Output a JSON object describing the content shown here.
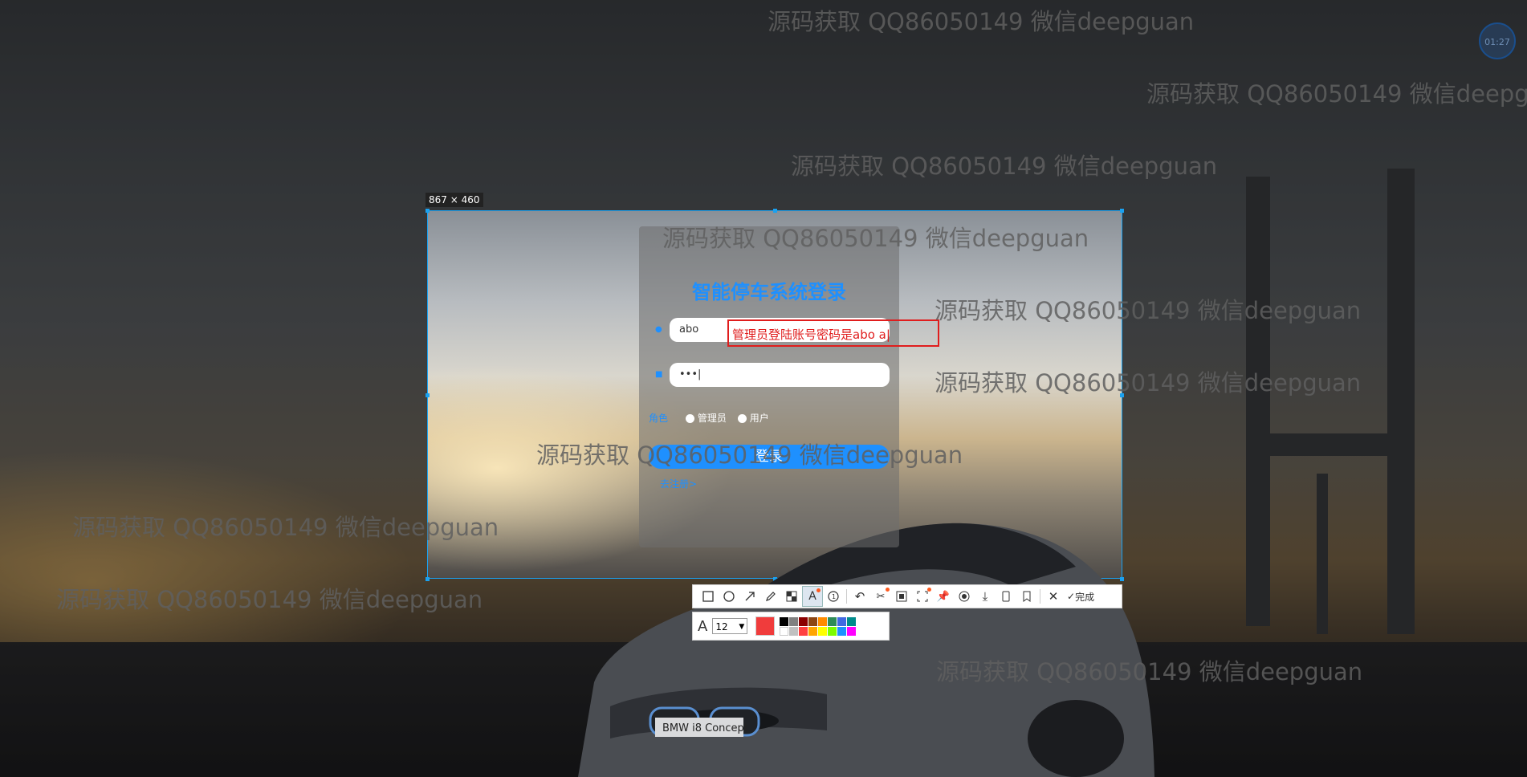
{
  "selection": {
    "size_label": "867 × 460"
  },
  "login": {
    "title": "智能停车系统登录",
    "username_value": "abo",
    "password_value": "•••|",
    "role_label": "角色",
    "role_options": [
      "管理员",
      "用户"
    ],
    "login_button": "登录",
    "register_link": "去注册>"
  },
  "annotation": {
    "text": "管理员登陆账号密码是abo a|"
  },
  "watermark": {
    "text": "源码获取 QQ86050149 微信deepguan"
  },
  "timer": {
    "text": "01:27"
  },
  "toolbar": {
    "tools": [
      "rectangle-icon",
      "ellipse-icon",
      "arrow-icon",
      "pencil-icon",
      "mosaic-icon",
      "text-icon",
      "number-icon",
      "undo-icon",
      "cut-icon",
      "ocr-icon",
      "screenshot-icon",
      "pin-icon",
      "record-icon",
      "download-icon",
      "phone-icon",
      "bookmark-icon"
    ],
    "close_icon": "close-icon",
    "done_label": "完成"
  },
  "text_toolbar": {
    "font_size": "12",
    "current_color": "#f03c3c",
    "palette": [
      "#000000",
      "#808080",
      "#8b0000",
      "#8b4513",
      "#ff8c00",
      "#2e8b57",
      "#4169e1",
      "#008b8b",
      "#ffffff",
      "#c0c0c0",
      "#ff4040",
      "#ffa500",
      "#ffff00",
      "#7cfc00",
      "#1e90ff",
      "#ff00ff"
    ]
  },
  "bottom_extra_colors": [
    "#800080",
    "#00ced1"
  ]
}
